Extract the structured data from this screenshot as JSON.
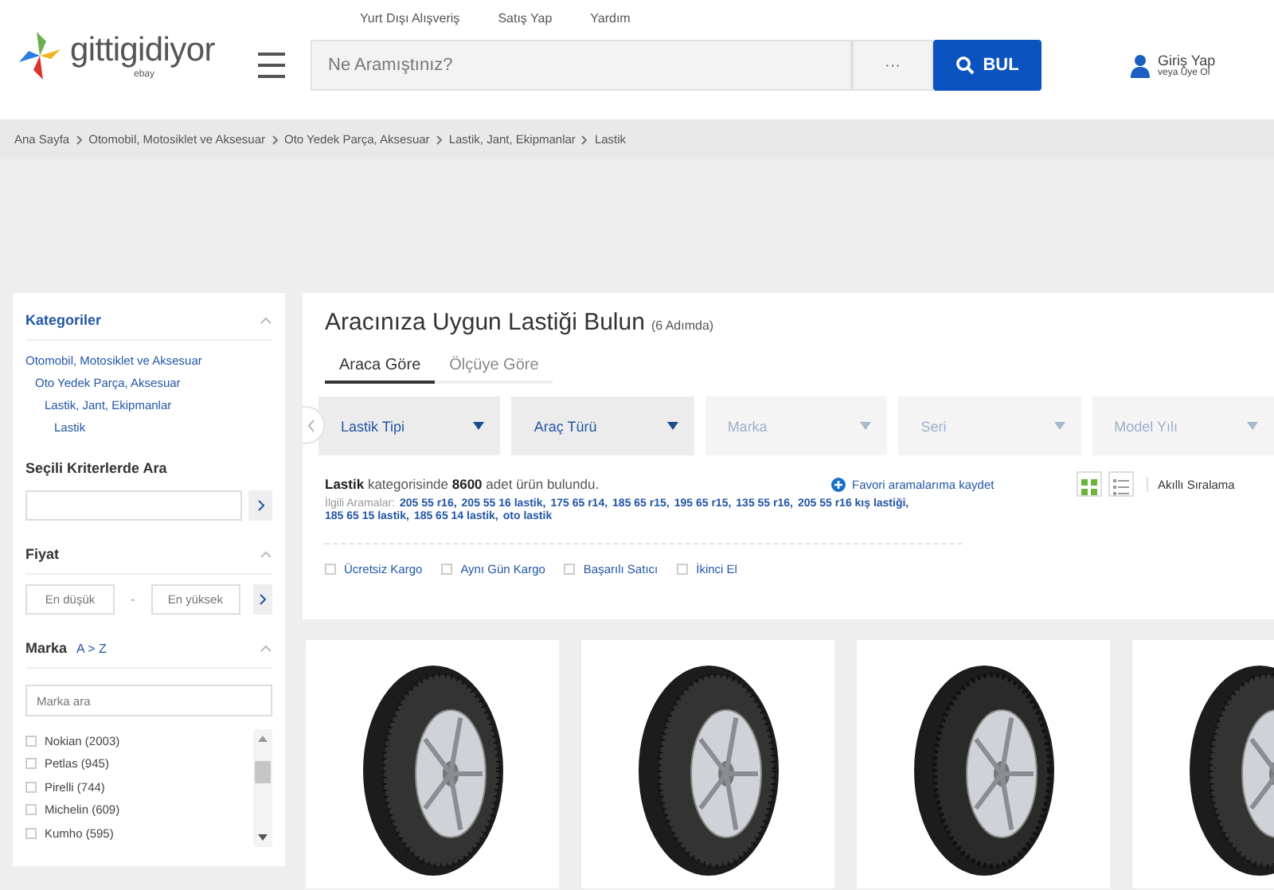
{
  "header": {
    "top_links": [
      "Yurt Dışı Alışveriş",
      "Satış Yap",
      "Yardım"
    ],
    "logo": {
      "name": "gittigidiyor",
      "sub": "ebay"
    },
    "search": {
      "placeholder": "Ne Aramıştınız?",
      "more": "···",
      "button": "BUL"
    },
    "account": {
      "title": "Giriş Yap",
      "sub": "veya Üye Ol"
    }
  },
  "breadcrumb": [
    "Ana Sayfa",
    "Otomobil, Motosiklet ve Aksesuar",
    "Oto Yedek Parça, Aksesuar",
    "Lastik, Jant, Ekipmanlar",
    "Lastik"
  ],
  "sidebar": {
    "categories": {
      "title": "Kategoriler",
      "expanded": true,
      "tree": [
        {
          "label": "Otomobil, Motosiklet ve Aksesuar",
          "children": [
            {
              "label": "Oto Yedek Parça, Aksesuar",
              "children": [
                {
                  "label": "Lastik, Jant, Ekipmanlar",
                  "children": [
                    {
                      "label": "Lastik"
                    }
                  ]
                }
              ]
            }
          ]
        }
      ]
    },
    "search_in": {
      "title": "Seçili Kriterlerde Ara"
    },
    "price": {
      "title": "Fiyat",
      "expanded": true,
      "min_placeholder": "En düşük",
      "separator": "-",
      "max_placeholder": "En yüksek"
    },
    "brand": {
      "title": "Marka",
      "sort": "A > Z",
      "expanded": true,
      "placeholder": "Marka ara",
      "items": [
        {
          "label": "Nokian (2003)",
          "checked": false
        },
        {
          "label": "Petlas (945)",
          "checked": false
        },
        {
          "label": "Pirelli (744)",
          "checked": false
        },
        {
          "label": "Michelin (609)",
          "checked": false
        },
        {
          "label": "Kumho (595)",
          "checked": false
        }
      ]
    }
  },
  "finder": {
    "title": "Aracınıza Uygun Lastiği Bulun",
    "steps": "(6 Adımda)",
    "tabs": [
      {
        "label": "Araca Göre",
        "selected": true
      },
      {
        "label": "Ölçüye Göre",
        "selected": false
      }
    ],
    "dropdowns": [
      {
        "label": "Lastik Tipi",
        "disabled": false
      },
      {
        "label": "Araç Türü",
        "disabled": false
      },
      {
        "label": "Marka",
        "disabled": true
      },
      {
        "label": "Seri",
        "disabled": true
      },
      {
        "label": "Model Yılı",
        "disabled": true
      }
    ]
  },
  "results": {
    "summary": "**Lastik** kategorisinde **8600** adet ürün bulundu.",
    "save_search": "Favori aramalarıma kaydet",
    "views": [
      {
        "kind": "grid",
        "selected": true
      },
      {
        "kind": "list",
        "selected": false
      }
    ],
    "sort": "Akıllı Sıralama",
    "related_label": "İlgili Aramalar:",
    "related": [
      "205 55 r16,",
      "205 55 16 lastik,",
      "175 65 r14,",
      "185 65 r15,",
      "195 65 r15,",
      "135 55 r16,",
      "205 55 r16 kış lastiği,",
      "185 65 15 lastik,",
      "185 65 14 lastik,",
      "oto lastik"
    ],
    "filters": [
      {
        "label": "Ücretsiz Kargo",
        "checked": false
      },
      {
        "label": "Aynı Gün Kargo",
        "checked": false
      },
      {
        "label": "Başarılı Satıcı",
        "checked": false
      },
      {
        "label": "İkinci El",
        "checked": false
      }
    ]
  },
  "products": [
    {
      "kind": "summer"
    },
    {
      "kind": "summer"
    },
    {
      "kind": "winter"
    },
    {
      "kind": "summer"
    }
  ]
}
